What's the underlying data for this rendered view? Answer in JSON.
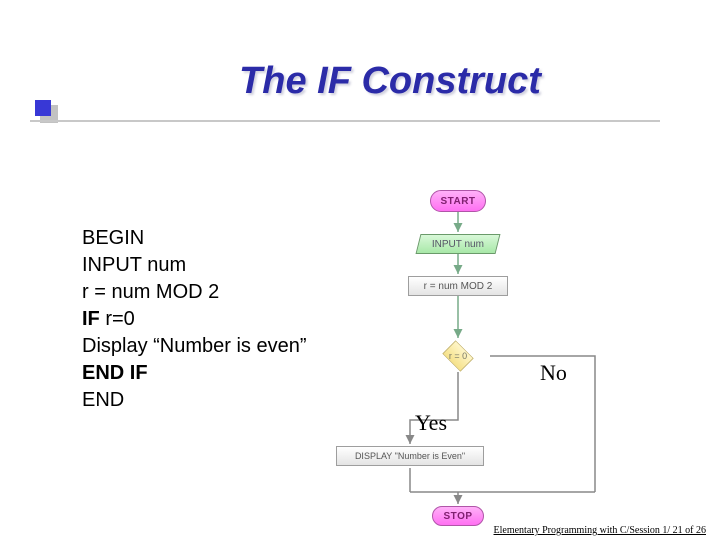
{
  "title": "The IF Construct",
  "pseudocode": {
    "l1": "BEGIN",
    "l2": "INPUT num",
    "l3": "r = num MOD 2",
    "l4_bold": "IF",
    "l4_rest": " r=0",
    "l5": "Display “Number is even”",
    "l6": "END IF",
    "l7": "END"
  },
  "flowchart": {
    "start": "START",
    "input": "INPUT num",
    "process": "r = num MOD 2",
    "decision": "r = 0",
    "display": "DISPLAY \"Number is Even\"",
    "stop": "STOP"
  },
  "branches": {
    "yes": "Yes",
    "no": "No"
  },
  "footer": "Elementary Programming with C/Session 1/ 21 of 26",
  "colors": {
    "title": "#2b2ba8",
    "terminator_fill": "#ff70f2",
    "io_fill": "#a8e8a8",
    "decision_fill": "#f5e18a"
  }
}
